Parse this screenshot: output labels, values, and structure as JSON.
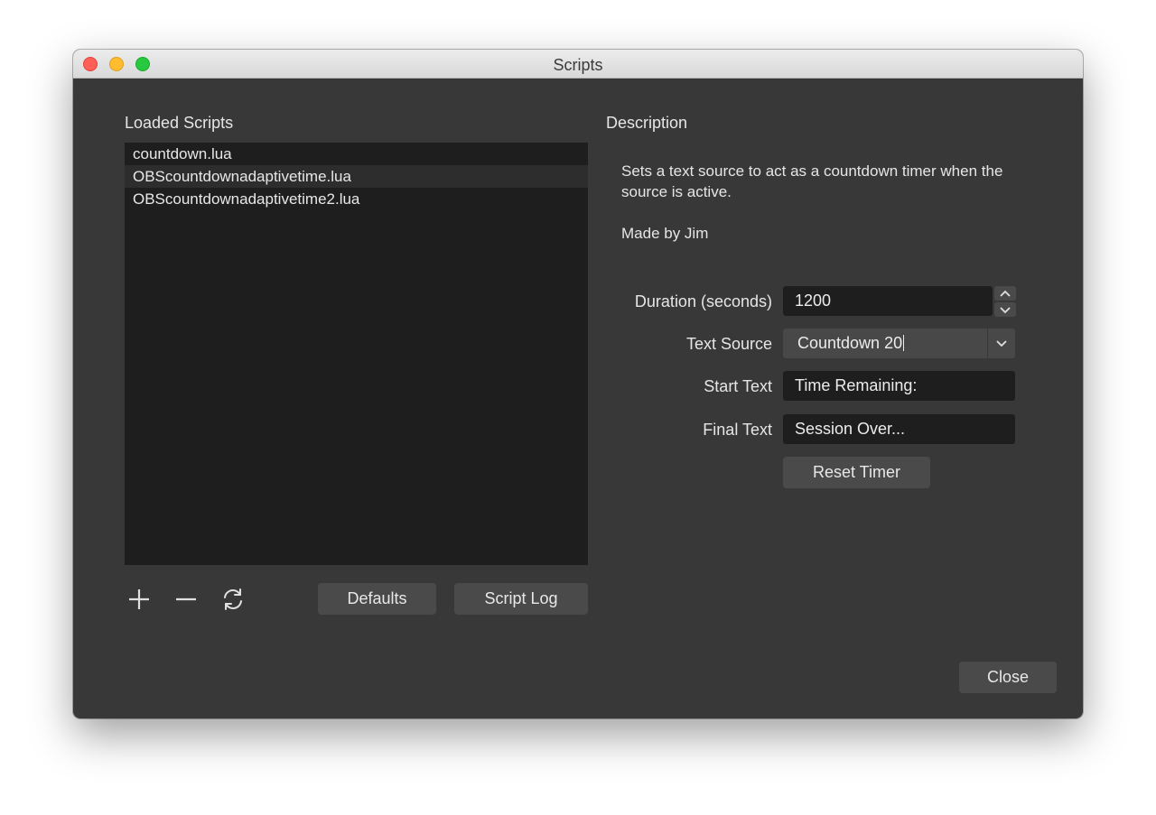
{
  "window": {
    "title": "Scripts"
  },
  "left_panel": {
    "heading": "Loaded Scripts",
    "scripts": [
      {
        "label": "countdown.lua",
        "selected": false
      },
      {
        "label": "OBScountdownadaptivetime.lua",
        "selected": true
      },
      {
        "label": "OBScountdownadaptivetime2.lua",
        "selected": false
      }
    ],
    "icons": {
      "add": "plus-icon",
      "remove": "minus-icon",
      "reload": "refresh-icon"
    },
    "defaults_label": "Defaults",
    "script_log_label": "Script Log"
  },
  "right_panel": {
    "heading": "Description",
    "description": "Sets a text source to act as a countdown timer when the source is active.",
    "author": "Made by Jim",
    "fields": {
      "duration": {
        "label": "Duration (seconds)",
        "value": "1200"
      },
      "text_source": {
        "label": "Text Source",
        "value": "Countdown 20"
      },
      "start_text": {
        "label": "Start Text",
        "value": "Time Remaining:"
      },
      "final_text": {
        "label": "Final Text",
        "value": "Session Over..."
      }
    },
    "reset_label": "Reset Timer"
  },
  "footer": {
    "close_label": "Close"
  },
  "colors": {
    "panel_bg": "#383838",
    "list_bg": "#1e1e1e",
    "button_bg": "#4a4a4a"
  }
}
